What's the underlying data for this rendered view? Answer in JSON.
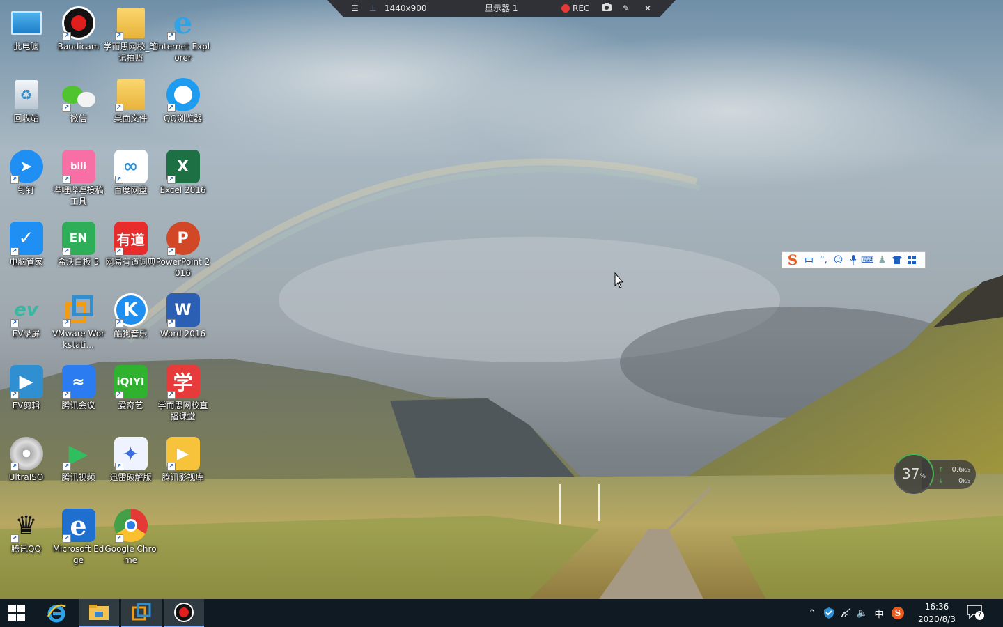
{
  "recorder": {
    "resolution": "1440x900",
    "monitor": "显示器 1",
    "rec_label": "REC"
  },
  "desktop_icons": [
    {
      "label": "此电脑",
      "icon": "this-pc-icon"
    },
    {
      "label": "Bandicam",
      "icon": "bandicam-icon"
    },
    {
      "label": "学而思网校_笔记拍照",
      "icon": "folder-icon"
    },
    {
      "label": "Internet Explorer",
      "icon": "internet-explorer-icon"
    },
    {
      "label": "回收站",
      "icon": "recycle-bin-icon"
    },
    {
      "label": "微信",
      "icon": "wechat-icon"
    },
    {
      "label": "桌面文件",
      "icon": "folder-icon"
    },
    {
      "label": "QQ浏览器",
      "icon": "qq-browser-icon"
    },
    {
      "label": "钉钉",
      "icon": "dingtalk-icon"
    },
    {
      "label": "哔哩哔哩投稿工具",
      "icon": "bilibili-icon"
    },
    {
      "label": "百度网盘",
      "icon": "baidu-netdisk-icon"
    },
    {
      "label": "Excel 2016",
      "icon": "excel-icon"
    },
    {
      "label": "电脑管家",
      "icon": "pc-manager-icon"
    },
    {
      "label": "希沃白板 5",
      "icon": "easinote-icon"
    },
    {
      "label": "网易有道词典",
      "icon": "youdao-icon"
    },
    {
      "label": "PowerPoint 2016",
      "icon": "powerpoint-icon"
    },
    {
      "label": "EV录屏",
      "icon": "ev-recorder-icon"
    },
    {
      "label": "VMware Workstati...",
      "icon": "vmware-icon"
    },
    {
      "label": "酷狗音乐",
      "icon": "kugou-icon"
    },
    {
      "label": "Word 2016",
      "icon": "word-icon"
    },
    {
      "label": "EV剪辑",
      "icon": "ev-editor-icon"
    },
    {
      "label": "腾讯会议",
      "icon": "tencent-meeting-icon"
    },
    {
      "label": "爱奇艺",
      "icon": "iqiyi-icon"
    },
    {
      "label": "学而思网校直播课堂",
      "icon": "xueersi-icon"
    },
    {
      "label": "UltraISO",
      "icon": "ultraiso-icon"
    },
    {
      "label": "腾讯视频",
      "icon": "tencent-video-icon"
    },
    {
      "label": "迅雷破解版",
      "icon": "xunlei-icon"
    },
    {
      "label": "腾讯影视库",
      "icon": "tencent-library-icon"
    },
    {
      "label": "腾讯QQ",
      "icon": "qq-icon"
    },
    {
      "label": "Microsoft Edge",
      "icon": "edge-icon"
    },
    {
      "label": "Google Chrome",
      "icon": "chrome-icon"
    }
  ],
  "ime": {
    "logo": "S",
    "mode": "中",
    "punct": "°,"
  },
  "net_widget": {
    "percent": "37",
    "percent_unit": "%",
    "upload": "0.6",
    "upload_unit": "K/s",
    "download": "0",
    "download_unit": "K/s"
  },
  "taskbar": {
    "apps": [
      "internet-explorer-icon",
      "file-explorer-icon",
      "vmware-icon",
      "bandicam-icon"
    ],
    "tray_ime": "中",
    "time": "16:36",
    "date": "2020/8/3",
    "notifications": "7"
  },
  "colors": {
    "taskbar": "#0f1a22",
    "accent": "#1d5fc2",
    "rec_red": "#e53935"
  }
}
